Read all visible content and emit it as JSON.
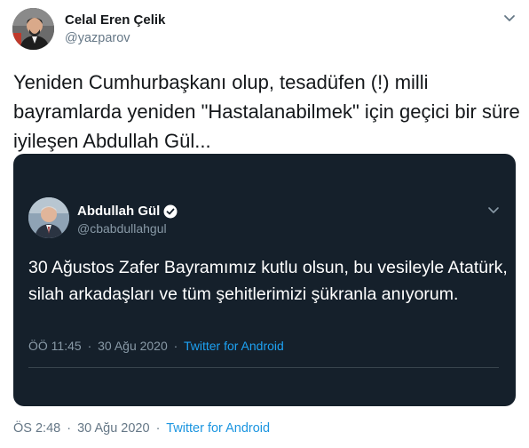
{
  "author": {
    "name": "Celal Eren Çelik",
    "handle": "@yazparov"
  },
  "tweet": {
    "text": "Yeniden Cumhurbaşkanı olup, tesadüfen (!) milli bayramlarda yeniden \"Hastalanabilmek\"  için geçici bir süre iyileşen Abdullah Gül...",
    "time": "ÖS 2:48",
    "date": "30 Ağu 2020",
    "source": "Twitter for Android",
    "separator": "·"
  },
  "embedded_tweet": {
    "name": "Abdullah Gül",
    "handle": "@cbabdullahgul",
    "text": "30 Ağustos Zafer Bayramımız kutlu olsun, bu vesileyle Atatürk, silah arkadaşları ve tüm şehitlerimizi şükranla anıyorum.",
    "time": "ÖÖ 11:45",
    "date": "30 Ağu 2020",
    "source": "Twitter for Android",
    "separator": "·"
  },
  "icons": {
    "caret": "chevron-down-icon",
    "verified": "verified-badge-icon"
  },
  "colors": {
    "link_blue": "#1b95e0",
    "dark_card_bg": "#15202b",
    "secondary_text": "#657786"
  }
}
